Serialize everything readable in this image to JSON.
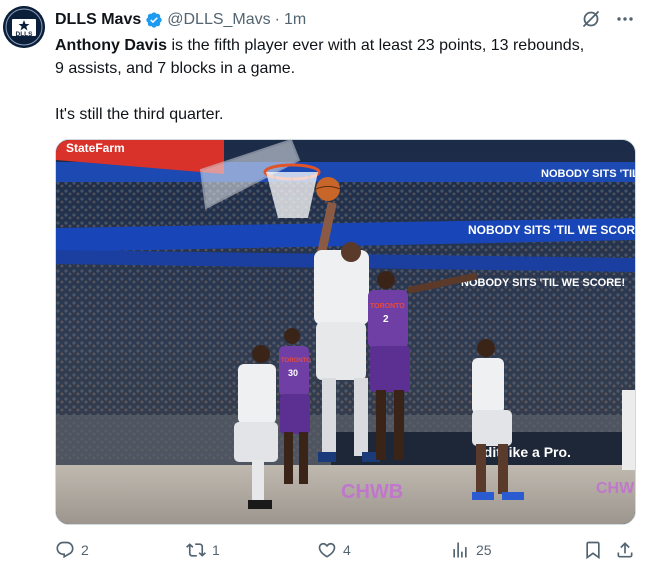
{
  "tweet": {
    "display_name": "DLLS Mavs",
    "handle": "@DLLS_Mavs",
    "separator": "·",
    "time": "1m",
    "avatar_text": "DLLS",
    "verified": true,
    "text_prefix": "Anthony Davis",
    "text_line1_rest": " is the fifth player ever with at least 23 points, 13 rebounds,",
    "text_line2": "9 assists, and 7 blocks in a game.",
    "text_line3": "It's still the third quarter."
  },
  "media": {
    "banner_top": "NOBODY SITS 'TIL WE SCORE!",
    "banner_mid": "NOBODY SITS 'TIL WE SCORE!",
    "banner_low": "NOBODY SITS 'TIL WE SCORE!",
    "backboard_sign": "StateFarm",
    "court_ad": "edit like a Pro.",
    "jersey_a": "TORONTO",
    "jersey_a_number": "2",
    "jersey_b": "TORONTO",
    "jersey_b_number": "30",
    "court_text_left": "CHWB",
    "court_text_right": "CHW"
  },
  "actions": {
    "replies": "2",
    "reposts": "1",
    "likes": "4",
    "views": "25"
  },
  "colors": {
    "accent": "#1d9bf0",
    "muted": "#536471",
    "text": "#0f1419"
  },
  "icons": [
    "grok-icon",
    "more-icon",
    "reply-icon",
    "repost-icon",
    "like-icon",
    "views-icon",
    "bookmark-icon",
    "share-icon",
    "verified-icon"
  ]
}
